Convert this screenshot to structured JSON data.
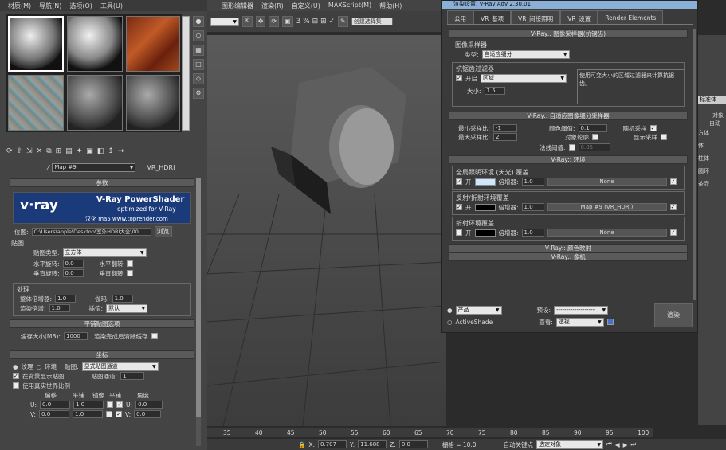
{
  "menu": {
    "items": [
      "材质(M)",
      "导航(N)",
      "选项(O)",
      "工具(U)"
    ]
  },
  "mainmenu": {
    "items": [
      "图形编辑器",
      "渲染(R)",
      "自定义(U)",
      "MAXScript(M)",
      "帮助(H)"
    ]
  },
  "toolbar": {
    "select_set": "创建选择集",
    "icon_row": "3 % ⊟ ⊞ ✓"
  },
  "mat": {
    "map_field": "Map #9",
    "map_type": "VR_HDRI",
    "rollout_params": "参数",
    "banner_brand": "v·ray",
    "banner_title": "V-Ray PowerShader",
    "banner_sub": "optimized for V-Ray",
    "banner_url": "汉化 ma5 www.toprender.com",
    "bitmap_label": "位图:",
    "bitmap_path": "C:\\Users\\apple\\Desktop\\室外HDRI大全\\00",
    "browse": "浏览",
    "group_map": "贴图",
    "map_type_label": "贴图类型:",
    "map_type_value": "立方体",
    "hrot_label": "水平旋转:",
    "hrot": "0.0",
    "hflip": "水平翻转",
    "vrot_label": "垂直旋转:",
    "vrot": "0.0",
    "vflip": "垂直翻转",
    "group_proc": "处理",
    "overall_label": "整体倍增器:",
    "overall": "1.0",
    "gamma_label": "伽玛:",
    "gamma": "1.0",
    "render_mult_label": "渲染倍增:",
    "render_mult": "1.0",
    "interp_label": "插值:",
    "interp": "默认",
    "rollout_tex": "平铺贴图选项",
    "cache_label": "缓存大小(MB):",
    "cache": "1000",
    "clear_cache": "渲染完成后清除缓存",
    "rollout_coord": "坐标",
    "radio_tex": "纹理",
    "radio_env": "环境",
    "map_label": "贴图:",
    "map_channel_sel": "显式贴图通道",
    "show_in_viewport": "在背景显示贴图",
    "map_channel_label": "贴图通道:",
    "map_channel": "1",
    "real_world": "使用真实世界比例",
    "col_offset": "偏移",
    "col_tiling": "平铺",
    "col_mirror": "镜像",
    "col_tile": "平铺",
    "col_angle": "角度",
    "u_label": "U:",
    "v_label": "V:",
    "u_off": "0.0",
    "u_tile": "1.0",
    "u_ang": "0.0",
    "v_off": "0.0",
    "v_tile": "1.0",
    "v_ang": "0.0",
    "w_lbl": "U:",
    "w_lbl2": "V:"
  },
  "dlg": {
    "title": "渲染设置: V-Ray Adv 2.30.01",
    "tabs": [
      "公用",
      "VR_基项",
      "VR_间接照明",
      "VR_设置",
      "Render Elements"
    ],
    "r1": "V-Ray:: 图像采样器(抗锯齿)",
    "sampler_group": "图像采样器",
    "type_label": "类型:",
    "type_value": "自适应细分",
    "aa_group": "抗锯齿过滤器",
    "aa_on": "开启",
    "aa_filter": "区域",
    "aa_desc": "使用可变大小的区域过滤器来计算抗锯齿。",
    "size_label": "大小:",
    "size": "1.5",
    "r2": "V-Ray:: 自适应图像细分采样器",
    "min_rate_label": "最小采样比:",
    "min_rate": "-1",
    "max_rate_label": "最大采样比:",
    "max_rate": "2",
    "clr_thresh_label": "颜色阈值:",
    "clr_thresh": "0.1",
    "obj_outline": "对象轮廓",
    "rand_samples": "随机采样",
    "show_samples": "显示采样",
    "normal_thresh_label": "法线阈值:",
    "normal_thresh": "0.05",
    "r3": "V-Ray:: 环境",
    "gi_group": "全局照明环境 (天光) 覆盖",
    "gi_on": "开",
    "gi_mult_label": "倍增器:",
    "gi_mult": "1.0",
    "gi_map": "None",
    "refl_group": "反射/折射环境覆盖",
    "refl_on": "开",
    "refl_mult_label": "倍增器:",
    "refl_mult": "1.0",
    "refl_map": "Map #9 (VR_HDRI)",
    "refr_group": "折射环境覆盖",
    "refr_on": "开",
    "refr_mult_label": "倍增器:",
    "refr_mult": "1.0",
    "refr_map": "None",
    "r4": "V-Ray:: 颜色映射",
    "r5": "V-Ray:: 像机",
    "radio_product": "产品",
    "radio_active": "ActiveShade",
    "preset_label": "预设:",
    "preset": "-------------------",
    "view_label": "查看:",
    "view": "透视",
    "render_btn": "渲染"
  },
  "right": {
    "items": [
      "方体",
      "体",
      "柱体",
      "圆环",
      "茶壶"
    ],
    "hdr": "标准体",
    "objtype": "对象",
    "auto": "自动"
  },
  "ruler": {
    "ticks": [
      "35",
      "40",
      "45",
      "50",
      "55",
      "60",
      "65",
      "70",
      "75",
      "80",
      "85",
      "90",
      "95",
      "100"
    ]
  },
  "status": {
    "x_label": "X:",
    "x": "0.707",
    "y_label": "Y:",
    "y": "11.688",
    "z_label": "Z:",
    "z": "0.0",
    "grid": "栅格 = 10.0",
    "autokey": "自动关键点",
    "selobj": "选定对象"
  }
}
